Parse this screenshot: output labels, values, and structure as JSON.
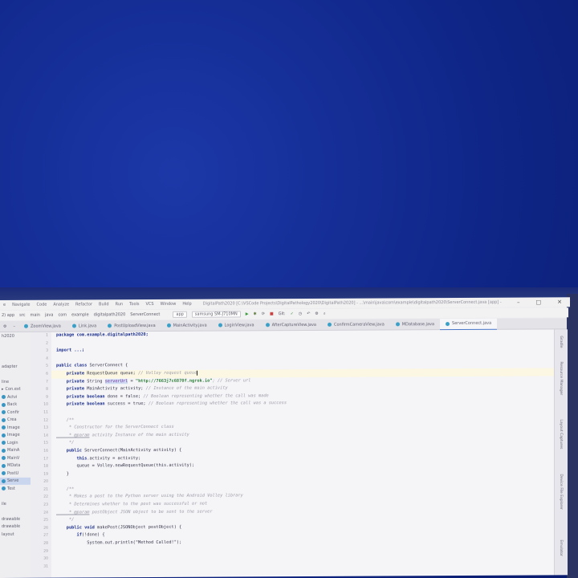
{
  "menu": {
    "items": [
      "e",
      "Navigate",
      "Code",
      "Analyze",
      "Refactor",
      "Build",
      "Run",
      "Tools",
      "VCS",
      "Window",
      "Help"
    ],
    "window_title": "DigitalPath2020 [C:\\VSCode Projects\\DigitalPathology2020\\DigitalPath2020] - ...\\main\\java\\com\\example\\digitalpath2020\\ServerConnect.java [app] -",
    "controls": [
      "–",
      "□",
      "✕"
    ]
  },
  "nav": {
    "crumbs": [
      "2) app",
      "src",
      "main",
      "java",
      "com",
      "example",
      "digitalpath2020",
      "ServerConnect"
    ],
    "run_config": "app",
    "device": "samsung SM-J710MN",
    "git_label": "Git:"
  },
  "tabs": [
    {
      "label": "ZoomView.java",
      "active": false
    },
    {
      "label": "Link.java",
      "active": false
    },
    {
      "label": "PostUploadView.java",
      "active": false
    },
    {
      "label": "MainActivity.java",
      "active": false
    },
    {
      "label": "LoginView.java",
      "active": false
    },
    {
      "label": "AfterCaptureView.java",
      "active": false
    },
    {
      "label": "ConfirmCameraView.java",
      "active": false
    },
    {
      "label": "MDatabase.java",
      "active": false
    },
    {
      "label": "ServerConnect.java",
      "active": true
    }
  ],
  "project": {
    "header": "h2020",
    "items": [
      "",
      "",
      "adapter",
      "",
      "",
      "",
      "line",
      "",
      "",
      "",
      "",
      "",
      "",
      "",
      "",
      "",
      "",
      "",
      "",
      "",
      "",
      "",
      "",
      "",
      "",
      "",
      "",
      "",
      "",
      "",
      "",
      "",
      ""
    ],
    "class_items": [
      "Con.ext",
      "Actvi",
      "Back",
      "Confir",
      "Crea",
      "Image",
      "Image",
      "Login",
      "MainA",
      "MainV",
      "MData",
      "PostU",
      "Serve",
      "Test"
    ],
    "bottom_items": [
      "ile",
      "",
      "drawable",
      "drawable",
      "layout"
    ]
  },
  "line_numbers": [
    "1",
    "2",
    "3",
    "4",
    "5",
    "6",
    "7",
    "8",
    "9",
    "10",
    "11",
    "12",
    "13",
    "14",
    "15",
    "16",
    "17",
    "18",
    "19",
    "20",
    "21",
    "22",
    "23",
    "24",
    "25",
    "26",
    "27",
    "28",
    "29",
    "30",
    "31"
  ],
  "code": {
    "l1": "package com.example.digitalpath2020;",
    "l3": "import ...;",
    "l5_kw": "public class",
    "l5_rest": " ServerConnect {",
    "l6_kw": "    private",
    "l6_rest": " RequestQueue queue; ",
    "l6_cm": "// Volley request queue",
    "l7_kw": "    private",
    "l7_rest": " String ",
    "l7_field": "serverUrl",
    "l7_eq": " = ",
    "l7_str": "\"http://7663j7c6870f.ngrok.io\"",
    "l7_cm": "; // Server url",
    "l8_kw": "    private",
    "l8_rest": " MainActivity activity; ",
    "l8_cm": "// Instance of the main activity",
    "l9_kw": "    private boolean",
    "l9_rest": " done = false; ",
    "l9_cm": "// Boolean representing whether the call was made",
    "l10_kw": "    private boolean",
    "l10_rest": " success = true; ",
    "l10_cm": "// Boolean representing whether the call was a success",
    "l12": "    /**",
    "l13": "     * Constructor for the ServerConnect class",
    "l14_tag": "     * @param",
    "l14_rest": " activity Instance of the main activity",
    "l15": "     */",
    "l16_kw": "    public",
    "l16_rest": " ServerConnect(MainActivity activity) {",
    "l17_kw": "        this",
    "l17_rest": ".activity = activity;",
    "l18": "        queue = Volley.newRequestQueue(this.activity);",
    "l19": "    }",
    "l21": "    /**",
    "l22": "     * Makes a post to the Python server using the Android Volley library",
    "l23": "     * Determines whether to the post was successful or not",
    "l24_tag": "     * @param",
    "l24_rest": " postObject JSON object to be sent to the server",
    "l25": "     */",
    "l26_kw": "    public void",
    "l26_rest": " makePost(JSONObject postObject) {",
    "l27_kw": "        if",
    "l27_rest": "(!done) {",
    "l28": "            System.out.println(\"Method Called!\");"
  },
  "right_strip": [
    "Gradle",
    "Resource Manager",
    "Layout Captures",
    "Device File Explorer",
    "Emulator"
  ],
  "colors": {
    "background": "#0f2688",
    "keyword": "#1b2e8c",
    "string": "#2d7d3a",
    "comment": "#9a9aa8",
    "field": "#6e2c96"
  }
}
